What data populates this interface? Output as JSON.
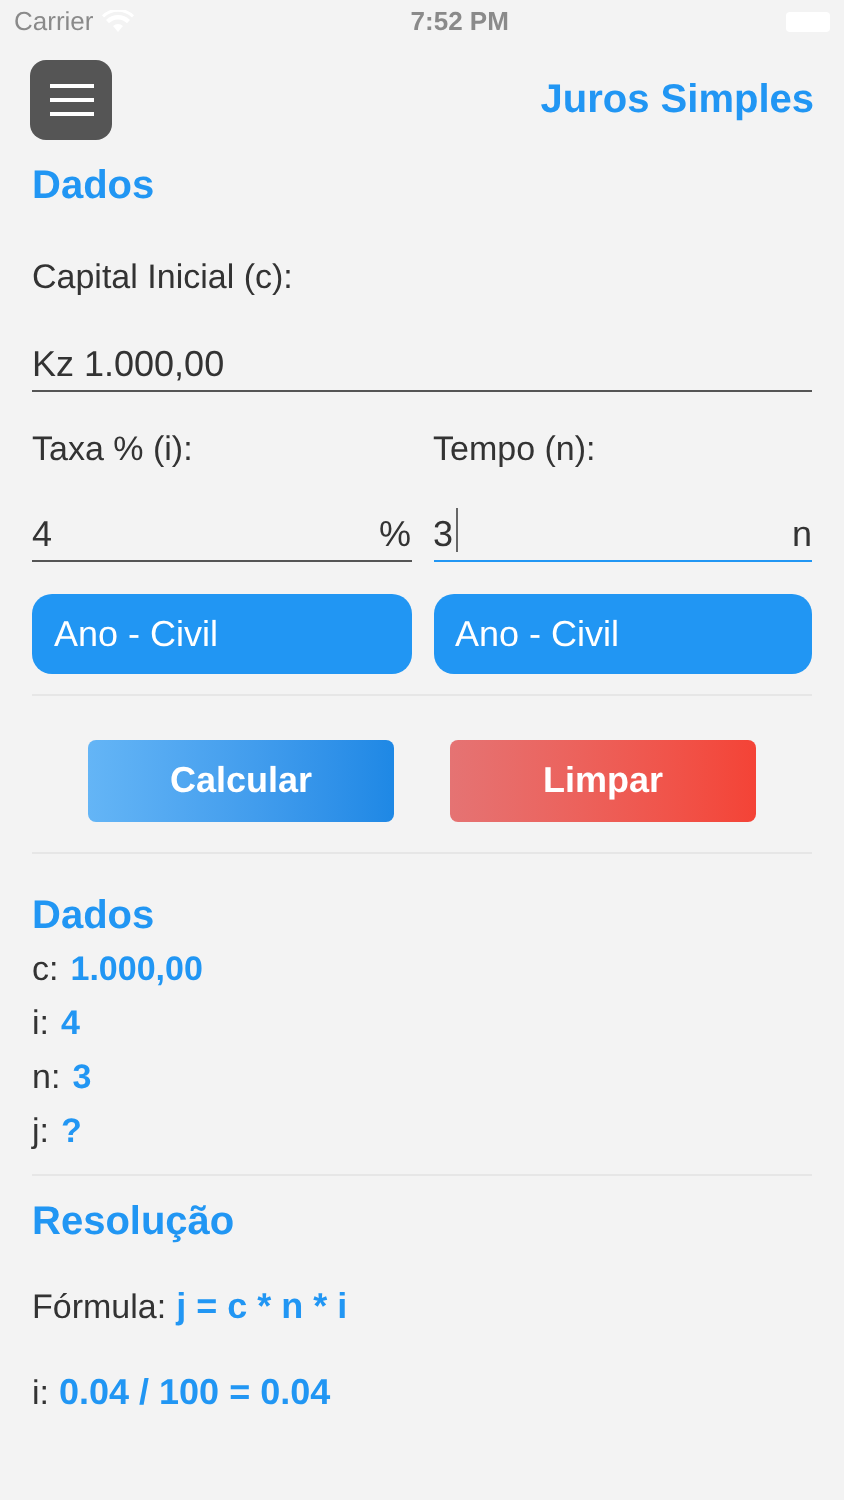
{
  "status_bar": {
    "carrier": "Carrier",
    "time": "7:52 PM"
  },
  "header": {
    "title": "Juros Simples"
  },
  "form": {
    "heading": "Dados",
    "capital": {
      "label": "Capital Inicial (c):",
      "value": "Kz 1.000,00",
      "focused": false
    },
    "fields": [
      {
        "label": "Taxa % (i):",
        "value": "4",
        "suffix": "%",
        "focused": false,
        "period": "Ano - Civil"
      },
      {
        "label": "Tempo (n):",
        "value": "3",
        "suffix": "n",
        "focused": true,
        "period": "Ano - Civil"
      }
    ],
    "buttons": [
      {
        "label": "Calcular",
        "kind": "primary"
      },
      {
        "label": "Limpar",
        "kind": "danger"
      }
    ]
  },
  "summary": {
    "heading": "Dados",
    "rows": [
      {
        "label": "c:",
        "value": "1.000,00"
      },
      {
        "label": "i:",
        "value": "4"
      },
      {
        "label": "n:",
        "value": "3"
      },
      {
        "label": "j:",
        "value": "?"
      }
    ]
  },
  "resolution": {
    "heading": "Resolução",
    "steps": [
      {
        "label": "Fórmula:",
        "value": "j = c * n * i"
      },
      {
        "label": "i:",
        "value": "0.04 / 100 = 0.04"
      }
    ]
  }
}
